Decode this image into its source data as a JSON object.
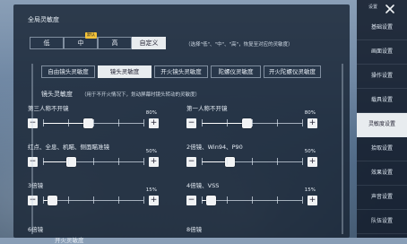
{
  "global": {
    "title": "全局灵敏度",
    "presets": [
      "低",
      "中",
      "高",
      "自定义"
    ],
    "selected_preset": 3,
    "recommend_badge": "默认",
    "hint": "（选择\"低\"、\"中\"、\"高\"，恢复至对应的灵敏度）"
  },
  "tabs": [
    "自由镜头灵敏度",
    "镜头灵敏度",
    "开火镜头灵敏度",
    "陀螺仪灵敏度",
    "开火陀螺仪灵敏度"
  ],
  "selected_tab": 1,
  "section": {
    "title": "镜头灵敏度",
    "note": "（用于不开火情况下，划动屏幕时镜头转动的灵敏度）"
  },
  "sliders": [
    {
      "label": "第三人称不开镜",
      "value_text": "80%",
      "fraction": 0.45
    },
    {
      "label": "第一人称不开镜",
      "value_text": "80%",
      "fraction": 0.45
    },
    {
      "label": "红点、全息、机瞄、侧面瞄准镜",
      "value_text": "50%",
      "fraction": 0.28
    },
    {
      "label": "2倍镜、Win94、P90",
      "value_text": "50%",
      "fraction": 0.28
    },
    {
      "label": "3倍镜",
      "value_text": "15%",
      "fraction": 0.09
    },
    {
      "label": "4倍镜、VSS",
      "value_text": "15%",
      "fraction": 0.09
    }
  ],
  "partial_labels": [
    "6倍镜",
    "8倍镜"
  ],
  "partial_bottom": "开火灵敏度",
  "sidebar": {
    "title": "设置",
    "items": [
      "基础设置",
      "画面设置",
      "操作设置",
      "载具设置",
      "灵敏度设置",
      "拾取设置",
      "效果设置",
      "声音设置",
      "队伍设置"
    ],
    "selected_index": 4
  }
}
